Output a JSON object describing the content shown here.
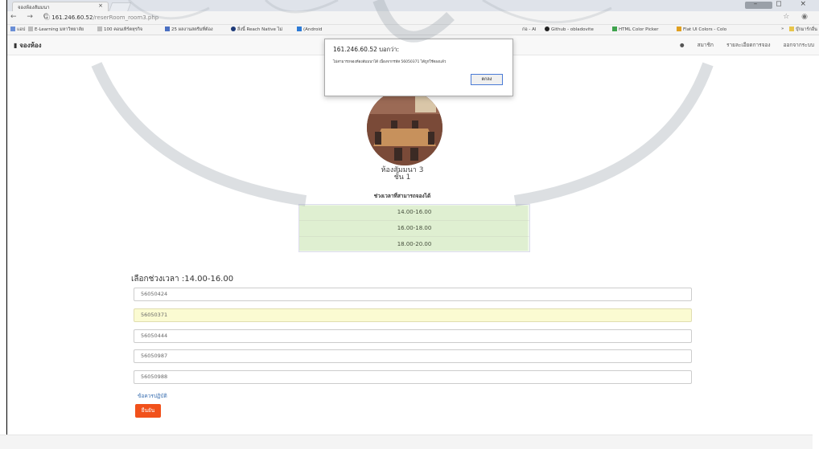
{
  "browser": {
    "tab_title": "จองห้องสัมมนา",
    "tab_close": "×",
    "url_host": "161.246.60.52",
    "url_path": "/reserRoom_room3.php",
    "url_prefix": "ⓘ",
    "nav_glyphs": "← → C",
    "addr_right_glyphs": "☆ ◉",
    "window_controls": "– ◻ ×",
    "bookmarks": [
      {
        "label": "แอป"
      },
      {
        "label": "E-Learning มหาวิทยาลัย"
      },
      {
        "label": "100 คอนเทิร์ตหุรกิจ"
      },
      {
        "label": "25 ผลงานสตรีมที่ต้อง"
      },
      {
        "label": "สิ่งนี้ Reach Native ไม่"
      },
      {
        "label": "(Android"
      },
      {
        "label": "ก่อ - Al"
      },
      {
        "label": "Github - obladovite"
      },
      {
        "label": "HTML Color Picker"
      },
      {
        "label": "Flat UI Colors - Colo"
      },
      {
        "label": "»"
      },
      {
        "label": "บุ๊กมาร์กอื่น"
      }
    ]
  },
  "navbar": {
    "brand": "จองห้อง",
    "brand_icon": "book-icon",
    "links": [
      "สมาชิก",
      "รายละเอียดการจอง",
      "ออกจากระบบ"
    ],
    "user_icon": "user-icon"
  },
  "dialog": {
    "title": "161.246.60.52 บอกว่า:",
    "message": "ไม่สามารถจองห้องสัมมนาได้ เนื่องจากรหัส 56050371 ได้ถูกใช้จองแล้ว",
    "ok_label": "ตกลง"
  },
  "room": {
    "name": "ห้องสัมมนา 3",
    "floor": "ชั้น 1",
    "slots_title": "ช่วงเวลาที่สามารถจองได้",
    "slots": [
      "14.00-16.00",
      "16.00-18.00",
      "18.00-20.00"
    ]
  },
  "form": {
    "selected_label": "เลือกช่วงเวลา :14.00-16.00",
    "fields": [
      "56050424",
      "56050371",
      "56050444",
      "56050987",
      "56050988"
    ],
    "terms_link": "ข้อควรปฏิบัติ",
    "submit_label": "ยืนยัน"
  },
  "colors": {
    "submit_bg": "#f1511b",
    "slots_bg": "#eef7e8",
    "highlight_field": "#fbfbd2",
    "link": "#3a6fb0"
  }
}
